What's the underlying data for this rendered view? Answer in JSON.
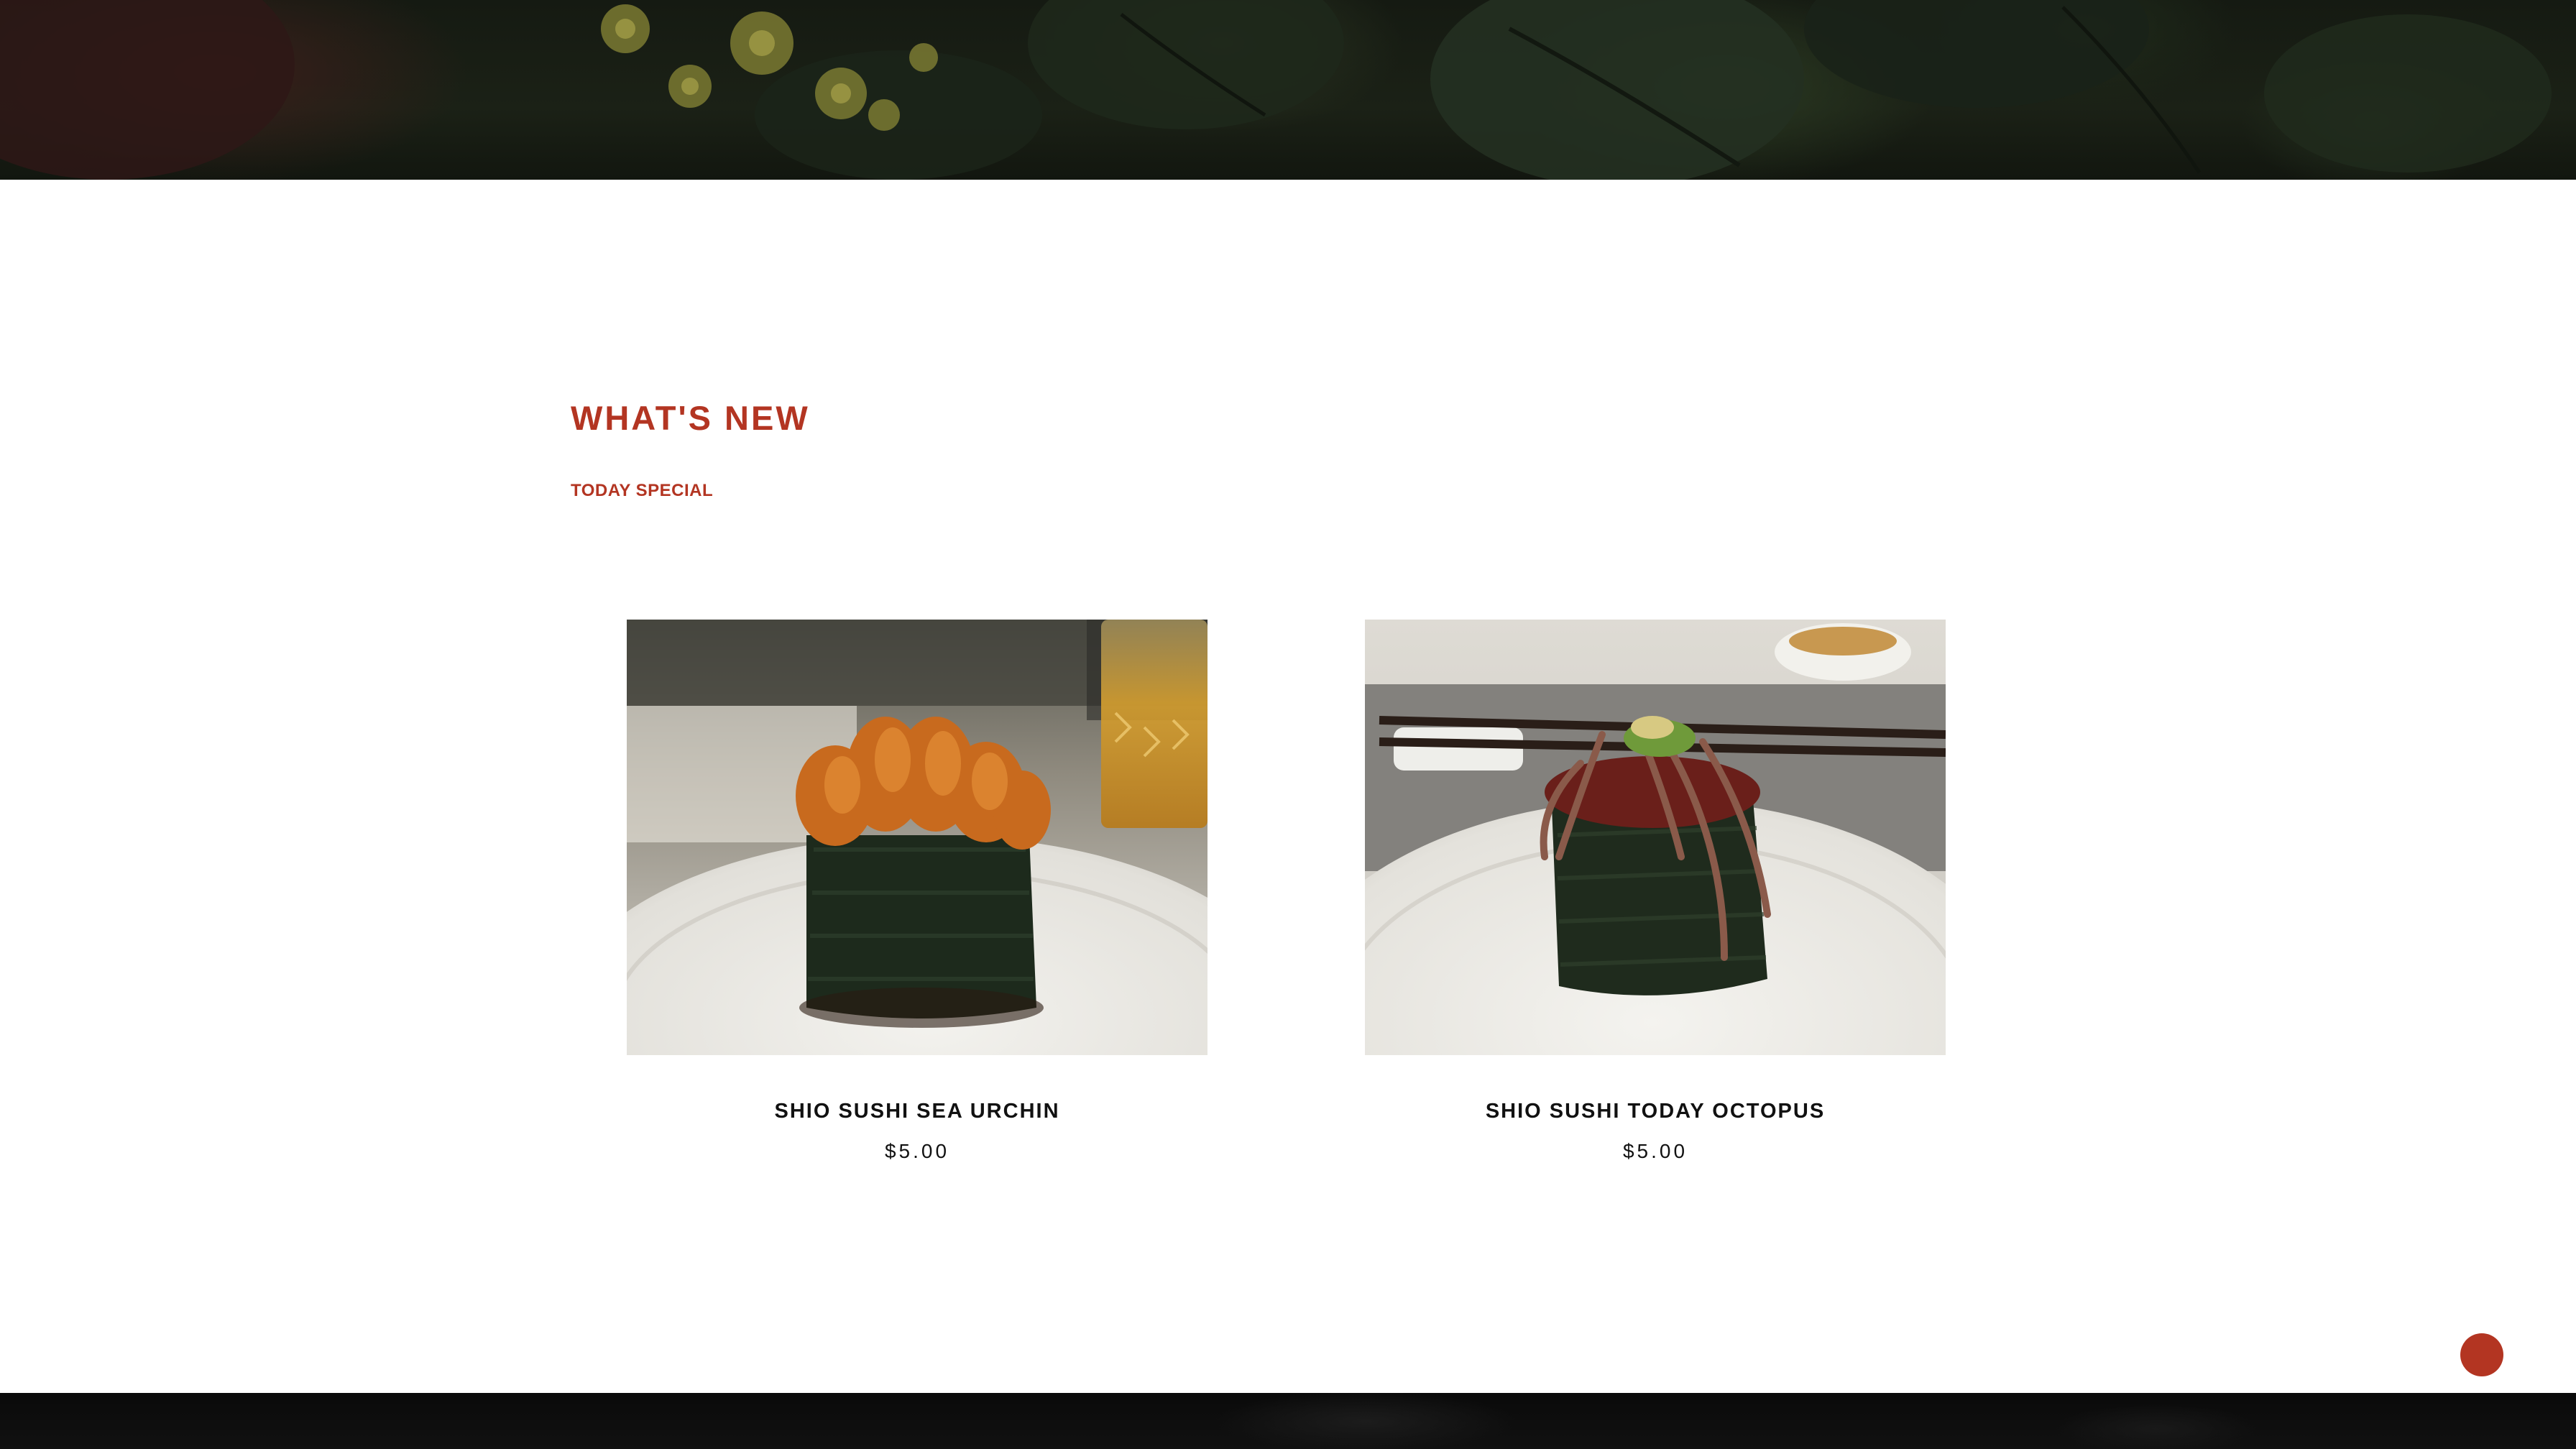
{
  "section": {
    "title": "WHAT'S NEW",
    "subtitle": "TODAY SPECIAL"
  },
  "products": [
    {
      "name": "SHIO SUSHI SEA URCHIN",
      "price": "$5.00",
      "image": "sea-urchin-sushi-photo"
    },
    {
      "name": "SHIO SUSHI TODAY OCTOPUS",
      "price": "$5.00",
      "image": "octopus-sushi-photo"
    }
  ],
  "chat_button": {
    "icon": "chat-bubble-icon"
  },
  "colors": {
    "accent": "#b33522",
    "text": "#111111",
    "background": "#ffffff",
    "hero_dark": "#151a12",
    "footer_dark": "#0a0a0a"
  }
}
